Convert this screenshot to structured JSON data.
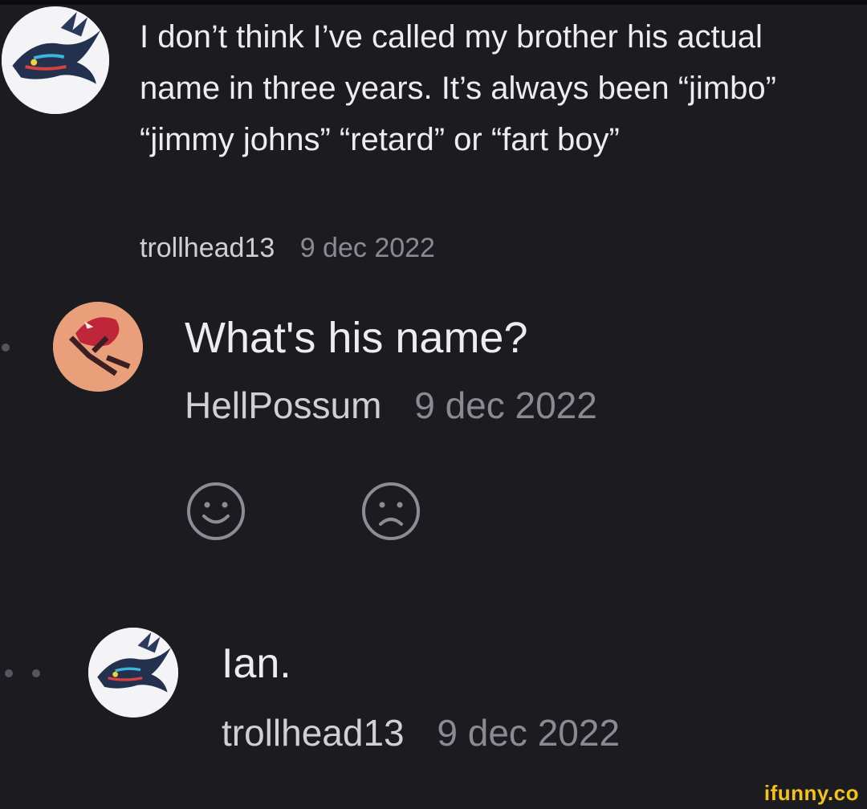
{
  "comments": [
    {
      "text": "I don’t think I’ve called my brother his actual name in three years. It’s always been “jimbo” “jimmy johns” “retard” or “fart boy”",
      "username": "trollhead13",
      "date": "9 dec 2022",
      "avatar_icon": "kyogre-avatar-icon"
    },
    {
      "text": "What's his name?",
      "username": "HellPossum",
      "date": "9 dec 2022",
      "avatar_icon": "pokemon-avatar-icon"
    },
    {
      "text": "Ian.",
      "username": "trollhead13",
      "date": "9 dec 2022",
      "avatar_icon": "kyogre-avatar-icon"
    }
  ],
  "reactions": {
    "like_icon": "smile-face-icon",
    "dislike_icon": "sad-face-icon"
  },
  "watermark": "ifunny.co",
  "colors": {
    "background": "#1c1c20",
    "text": "#ededf0",
    "username": "#cfcfd4",
    "date": "#8a8a90",
    "watermark": "#f3c21b"
  }
}
